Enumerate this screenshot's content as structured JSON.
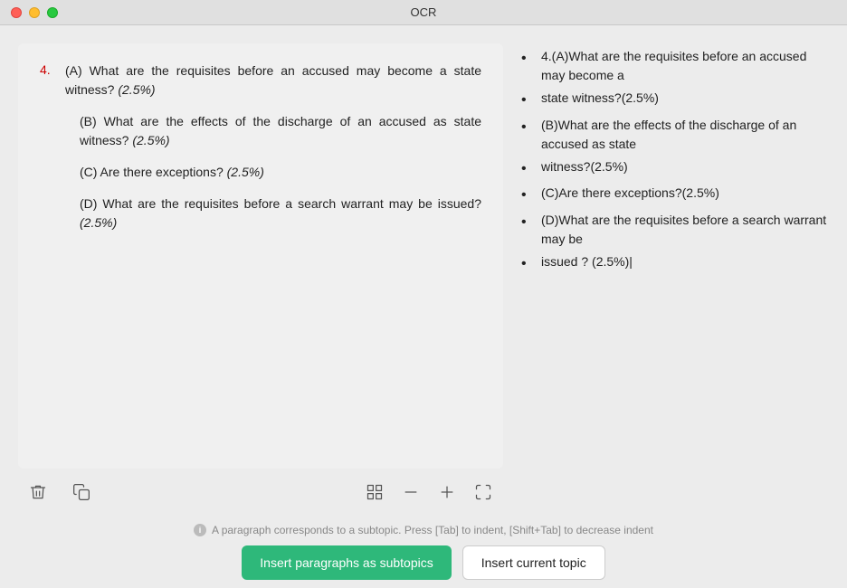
{
  "titlebar": {
    "title": "OCR"
  },
  "left_panel": {
    "question_number": "4.",
    "question_parts": [
      {
        "label": "(A) What are the requisites before an accused may become a state witness?",
        "points": "(2.5%)"
      },
      {
        "label": "(B) What are the effects of the discharge of an accused as state witness?",
        "points": "(2.5%)"
      },
      {
        "label": "(C) Are there exceptions?",
        "points": "(2.5%)"
      },
      {
        "label": "(D) What are the requisites before a search warrant may be issued?",
        "points": "(2.5%)"
      }
    ]
  },
  "right_panel": {
    "items": [
      "4.(A)What are the requisites before an accused may become a",
      "state witness?(2.5%)",
      "(B)What are the effects of the discharge of an accused as state",
      "witness?(2.5%)",
      "(C)Are there exceptions?(2.5%)",
      "(D)What are the requisites before a search warrant may be",
      "issued ? (2.5%)"
    ]
  },
  "toolbar": {
    "delete_label": "delete",
    "copy_label": "copy",
    "frame_label": "frame",
    "minus_label": "minus",
    "plus_label": "plus",
    "fullscreen_label": "fullscreen"
  },
  "bottom": {
    "hint_text": "A paragraph corresponds to a subtopic. Press [Tab] to indent, [Shift+Tab] to decrease indent",
    "hint_icon": "i",
    "btn_primary_label": "Insert paragraphs as subtopics",
    "btn_secondary_label": "Insert current topic"
  }
}
